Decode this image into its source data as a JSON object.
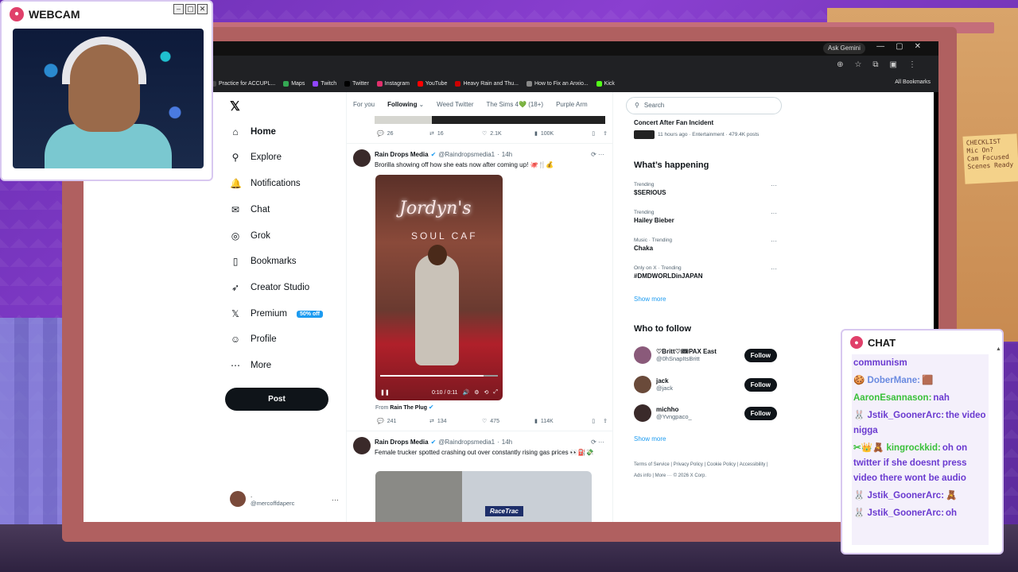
{
  "overlay": {
    "webcam_title": "WEBCAM",
    "chat_title": "CHAT",
    "note_text": "CHECKLIST\nMic On?\nCam Focused\nScenes Ready"
  },
  "browser": {
    "ask_gemini": "Ask Gemini",
    "all_bookmarks": "All Bookmarks",
    "bookmarks": [
      {
        "label": "Practice for ACCUPL...",
        "color": "#444444"
      },
      {
        "label": "Maps",
        "color": "#34a853"
      },
      {
        "label": "Twitch",
        "color": "#9146ff"
      },
      {
        "label": "Twitter",
        "color": "#000000"
      },
      {
        "label": "Instagram",
        "color": "#e1306c"
      },
      {
        "label": "YouTube",
        "color": "#ff0000"
      },
      {
        "label": "Heavy Rain and Thu...",
        "color": "#cc0000"
      },
      {
        "label": "How to Fix an Anxio...",
        "color": "#888888"
      },
      {
        "label": "Kick",
        "color": "#53fc18"
      }
    ]
  },
  "nav": {
    "items": [
      {
        "label": "Home",
        "icon": "⌂",
        "name": "home"
      },
      {
        "label": "Explore",
        "icon": "⚲",
        "name": "explore"
      },
      {
        "label": "Notifications",
        "icon": "🔔",
        "name": "notifications"
      },
      {
        "label": "Chat",
        "icon": "✉",
        "name": "chat"
      },
      {
        "label": "Grok",
        "icon": "◎",
        "name": "grok"
      },
      {
        "label": "Bookmarks",
        "icon": "▯",
        "name": "bookmarks"
      },
      {
        "label": "Creator Studio",
        "icon": "➶",
        "name": "creator-studio"
      },
      {
        "label": "Premium",
        "icon": "𝕏",
        "name": "premium"
      },
      {
        "label": "Profile",
        "icon": "☺",
        "name": "profile"
      },
      {
        "label": "More",
        "icon": "⋯",
        "name": "more"
      }
    ],
    "premium_badge": "50% off",
    "post_button": "Post",
    "account_name": ".",
    "account_handle": "@mercoffdaperc"
  },
  "feed": {
    "tabs": [
      "For you",
      "Following",
      "Weed Twitter",
      "The Sims 4💚 (18+)",
      "Purple Arm"
    ],
    "prev_actions": {
      "replies": "26",
      "reposts": "16",
      "likes": "2.1K",
      "views": "100K"
    },
    "tweet1": {
      "name": "Rain Drops Media",
      "handle": "@Raindropsmedia1",
      "time": "14h",
      "text": "Brorilla showing off how she eats now after coming up! 🐙🍴💰",
      "video_neon": "Jordyn's",
      "video_neon2": "SOUL CAF",
      "video_time": "0:10 / 0:11",
      "from_label": "From",
      "from_name": "Rain The Plug",
      "actions": {
        "replies": "241",
        "reposts": "134",
        "likes": "475",
        "views": "114K"
      }
    },
    "tweet2": {
      "name": "Rain Drops Media",
      "handle": "@Raindropsmedia1",
      "time": "14h",
      "text": "Female trucker spotted crashing out over constantly rising gas prices 👀⛽💸",
      "media_label": "RaceTrac"
    }
  },
  "sidebar": {
    "search_placeholder": "Search",
    "top_trend_title": "Concert After Fan Incident",
    "top_trend_meta": "11 hours ago · Entertainment · 479.4K posts",
    "whats_happening": "What’s happening",
    "trends": [
      {
        "category": "Trending",
        "name": "$SERIOUS"
      },
      {
        "category": "Trending",
        "name": "Hailey Bieber"
      },
      {
        "category": "Music · Trending",
        "name": "Chaka"
      },
      {
        "category": "Only on X · Trending",
        "name": "#DMDWORLDinJAPAN"
      }
    ],
    "show_more": "Show more",
    "who_to_follow": "Who to follow",
    "follow_label": "Follow",
    "follows": [
      {
        "name": "♡Britt♡🎟PAX East",
        "handle": "@0hSnapItsBritt",
        "color": "#8a5a7a"
      },
      {
        "name": "jack",
        "handle": "@jack",
        "color": "#6a4a3a"
      },
      {
        "name": "michho",
        "handle": "@Yvngpaco_",
        "color": "#3a2a2a"
      }
    ],
    "footer": "Terms of Service  |  Privacy Policy  |  Cookie Policy  |  Accessibility  |  Ads info  |  More ···  © 2026 X Corp."
  },
  "chat": {
    "messages": [
      {
        "user": "",
        "text": "communism",
        "color": "#6a3ad0"
      },
      {
        "user": "🍪 DoberMane:",
        "text": "🟫",
        "color": "#6a8ae0"
      },
      {
        "user": "AaronEsannason:",
        "text": "nah",
        "color": "#3ac03a"
      },
      {
        "user": "🐰 Jstik_GoonerArc:",
        "text": "the video nigga",
        "color": "#6a3ad0"
      },
      {
        "user": "✂👑🧸 kingrockkid:",
        "text": "oh on twitter if she doesnt press video there wont be audio",
        "color": "#3ac03a"
      },
      {
        "user": "🐰 Jstik_GoonerArc:",
        "text": "🧸",
        "color": "#6a3ad0"
      },
      {
        "user": "🐰 Jstik_GoonerArc:",
        "text": "oh",
        "color": "#6a3ad0"
      }
    ]
  }
}
